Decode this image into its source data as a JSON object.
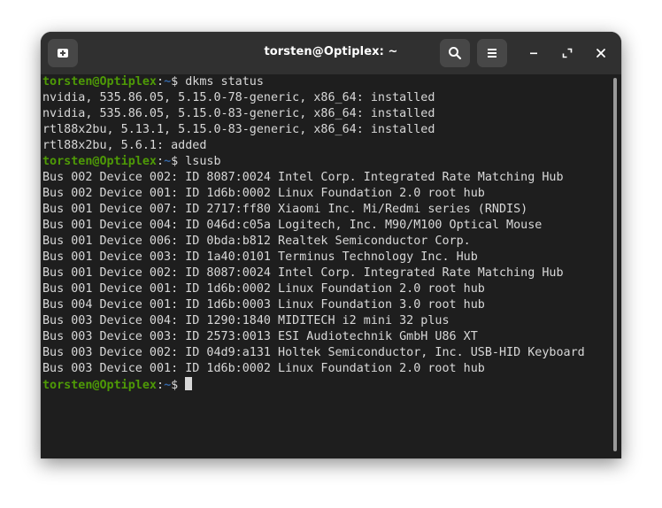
{
  "window": {
    "title": "torsten@Optiplex: ~"
  },
  "header": {
    "new_tab_icon": "new-tab-icon",
    "search_icon": "search-icon",
    "menu_icon": "hamburger-menu-icon",
    "minimize_icon": "minimize-icon",
    "maximize_icon": "maximize-icon",
    "close_icon": "close-icon"
  },
  "prompt": {
    "user_host": "torsten@Optiplex",
    "colon": ":",
    "path": "~",
    "symbol": "$ "
  },
  "lines": [
    {
      "type": "prompt",
      "cmd": "dkms status"
    },
    {
      "type": "out",
      "text": "nvidia, 535.86.05, 5.15.0-78-generic, x86_64: installed"
    },
    {
      "type": "out",
      "text": "nvidia, 535.86.05, 5.15.0-83-generic, x86_64: installed"
    },
    {
      "type": "out",
      "text": "rtl88x2bu, 5.13.1, 5.15.0-83-generic, x86_64: installed"
    },
    {
      "type": "out",
      "text": "rtl88x2bu, 5.6.1: added"
    },
    {
      "type": "prompt",
      "cmd": "lsusb"
    },
    {
      "type": "out",
      "text": "Bus 002 Device 002: ID 8087:0024 Intel Corp. Integrated Rate Matching Hub"
    },
    {
      "type": "out",
      "text": "Bus 002 Device 001: ID 1d6b:0002 Linux Foundation 2.0 root hub"
    },
    {
      "type": "out",
      "text": "Bus 001 Device 007: ID 2717:ff80 Xiaomi Inc. Mi/Redmi series (RNDIS)"
    },
    {
      "type": "out",
      "text": "Bus 001 Device 004: ID 046d:c05a Logitech, Inc. M90/M100 Optical Mouse"
    },
    {
      "type": "out",
      "text": "Bus 001 Device 006: ID 0bda:b812 Realtek Semiconductor Corp."
    },
    {
      "type": "out",
      "text": "Bus 001 Device 003: ID 1a40:0101 Terminus Technology Inc. Hub"
    },
    {
      "type": "out",
      "text": "Bus 001 Device 002: ID 8087:0024 Intel Corp. Integrated Rate Matching Hub"
    },
    {
      "type": "out",
      "text": "Bus 001 Device 001: ID 1d6b:0002 Linux Foundation 2.0 root hub"
    },
    {
      "type": "out",
      "text": "Bus 004 Device 001: ID 1d6b:0003 Linux Foundation 3.0 root hub"
    },
    {
      "type": "out",
      "text": "Bus 003 Device 004: ID 1290:1840 MIDITECH i2 mini 32 plus"
    },
    {
      "type": "out",
      "text": "Bus 003 Device 003: ID 2573:0013 ESI Audiotechnik GmbH U86 XT"
    },
    {
      "type": "out",
      "text": "Bus 003 Device 002: ID 04d9:a131 Holtek Semiconductor, Inc. USB-HID Keyboard"
    },
    {
      "type": "out",
      "text": "Bus 003 Device 001: ID 1d6b:0002 Linux Foundation 2.0 root hub"
    },
    {
      "type": "prompt",
      "cmd": "",
      "cursor": true
    }
  ],
  "colors": {
    "prompt_user": "#4e9a06",
    "prompt_path": "#3465a4",
    "text": "#d8d8d8",
    "background": "#1e1e1e",
    "header": "#303030"
  }
}
